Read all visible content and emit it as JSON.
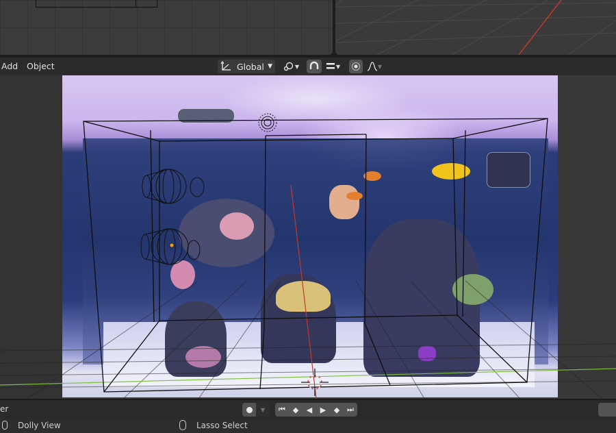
{
  "header": {
    "menu": [
      "Add",
      "Object"
    ],
    "orientation": "Global",
    "proportional_icon": "proportional-falloff-icon"
  },
  "timeline": {
    "left_label": "er"
  },
  "statusbar": {
    "items": [
      {
        "icon": "mouse-middle-icon",
        "label": "Dolly View"
      },
      {
        "icon": "mouse-right-icon",
        "label": "Lasso Select"
      }
    ]
  },
  "colors": {
    "background": "#1d1d1d",
    "header": "#2b2b2b",
    "viewport": "#3c3c3c",
    "x_axis": "#c0392b",
    "y_axis": "#7fbf3f",
    "selected_origin": "#f29a1d"
  }
}
